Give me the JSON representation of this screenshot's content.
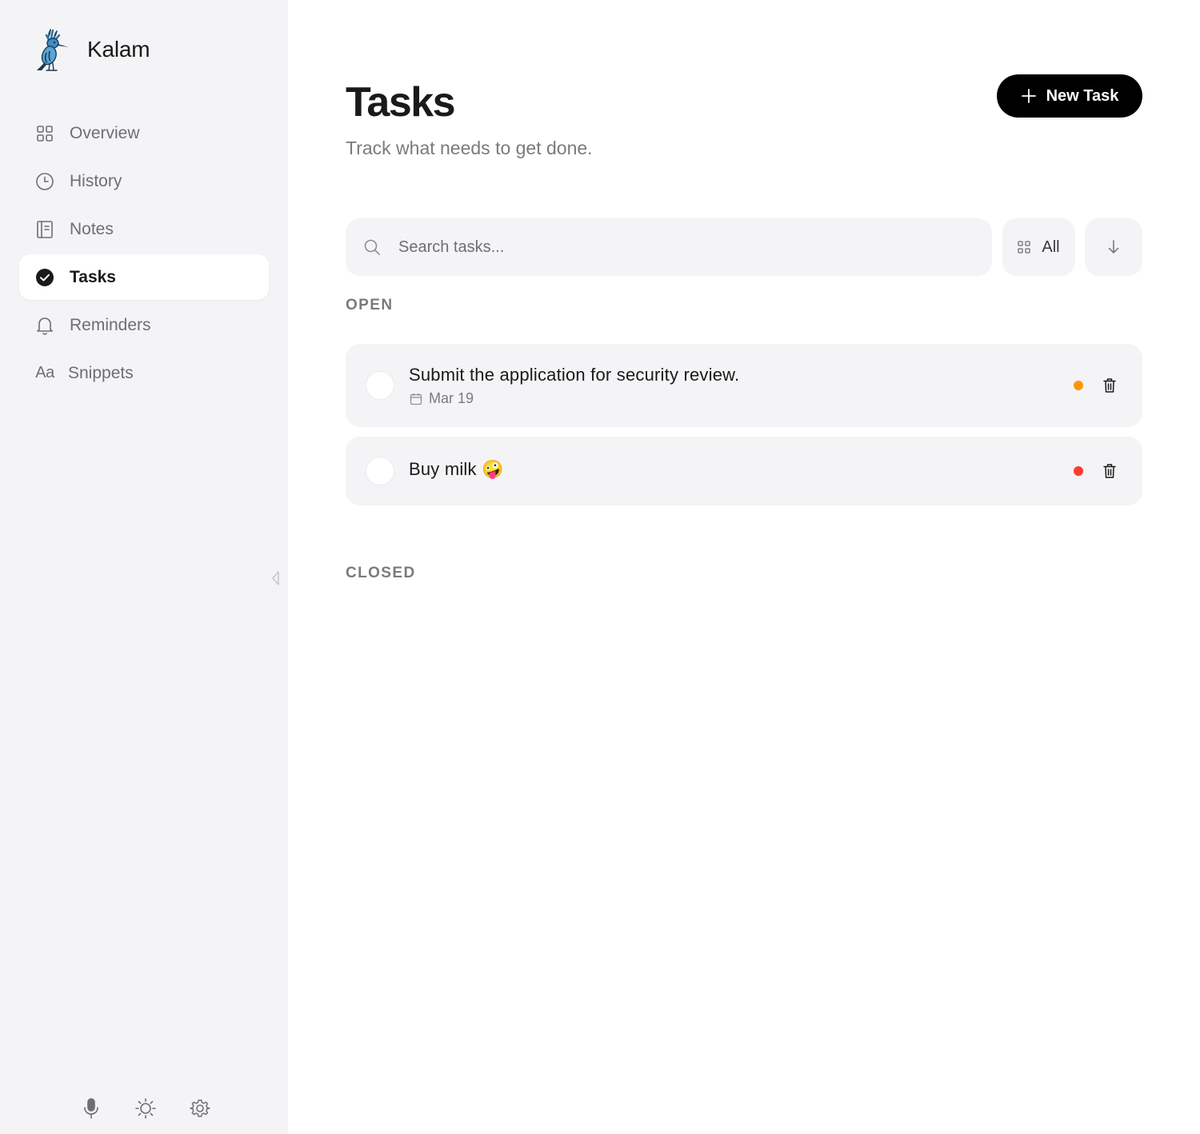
{
  "app": {
    "name": "Kalam"
  },
  "sidebar": {
    "items": [
      {
        "label": "Overview",
        "icon": "grid-icon",
        "active": false
      },
      {
        "label": "History",
        "icon": "clock-icon",
        "active": false
      },
      {
        "label": "Notes",
        "icon": "notebook-icon",
        "active": false
      },
      {
        "label": "Tasks",
        "icon": "check-circle-icon",
        "active": true
      },
      {
        "label": "Reminders",
        "icon": "bell-icon",
        "active": false
      },
      {
        "label": "Snippets",
        "icon": "text-aa-icon",
        "active": false
      }
    ],
    "footer": [
      "microphone-icon",
      "sun-icon",
      "gear-icon"
    ]
  },
  "header": {
    "title": "Tasks",
    "subtitle": "Track what needs to get done.",
    "new_task_label": "New Task"
  },
  "toolbar": {
    "search_placeholder": "Search tasks...",
    "filter_label": "All"
  },
  "sections": {
    "open_label": "OPEN",
    "closed_label": "CLOSED"
  },
  "tasks": {
    "open": [
      {
        "title": "Submit the application for security review.",
        "due": "Mar 19",
        "priority_color": "#ff9500"
      },
      {
        "title": "Buy milk 🤪",
        "due": "",
        "priority_color": "#ff3b30"
      }
    ],
    "closed": []
  },
  "colors": {
    "sidebar_bg": "#f4f4f6",
    "accent": "#000000",
    "priority_medium": "#ff9500",
    "priority_high": "#ff3b30"
  }
}
